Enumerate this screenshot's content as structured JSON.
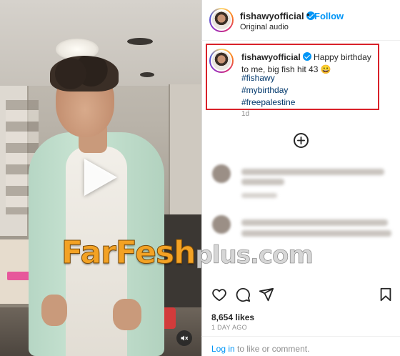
{
  "post": {
    "username": "fishawyofficial",
    "follow_label": "Follow",
    "separator": "•",
    "audio_label": "Original audio"
  },
  "caption": {
    "username": "fishawyofficial",
    "text": "Happy birthday to me, big fish hit 43 😀",
    "hashtags": [
      "#fishawy",
      "#mybirthday",
      "#freepalestine"
    ],
    "age": "1d"
  },
  "watermark": {
    "main": "FarFesh",
    "suffix": "plus.com"
  },
  "footer": {
    "likes": "8,654 likes",
    "post_age": "1 DAY AGO",
    "login_link": "Log in",
    "login_rest": " to like or comment."
  },
  "icons": {
    "verified": "verified-badge-icon",
    "load_more": "plus-circle-icon",
    "like": "heart-icon",
    "comment": "comment-bubble-icon",
    "share": "paper-plane-icon",
    "save": "bookmark-icon",
    "play": "play-icon",
    "mute": "speaker-muted-icon"
  },
  "colors": {
    "follow_blue": "#0095f6",
    "hashtag_blue": "#00376b",
    "highlight_red": "#d9222a"
  }
}
